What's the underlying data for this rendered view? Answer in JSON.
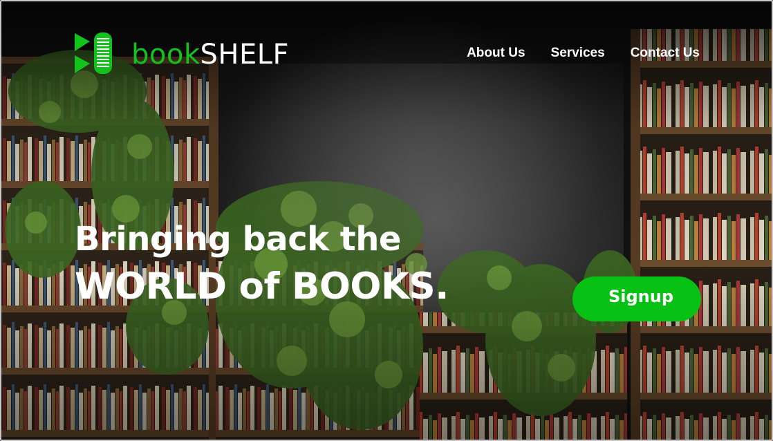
{
  "brand": {
    "name_part1": "book",
    "name_part2": "SHELF",
    "logo_icon": "book-stack-icon",
    "accent_color": "#14c21c"
  },
  "nav": {
    "items": [
      {
        "label": "About Us"
      },
      {
        "label": "Services"
      },
      {
        "label": "Contact Us"
      }
    ]
  },
  "hero": {
    "line1": "Bringing back the",
    "line2": "WORLD of BOOKS.",
    "background": "bookshelves-with-ivy-photo"
  },
  "cta": {
    "label": "Signup",
    "color": "#07c214"
  }
}
